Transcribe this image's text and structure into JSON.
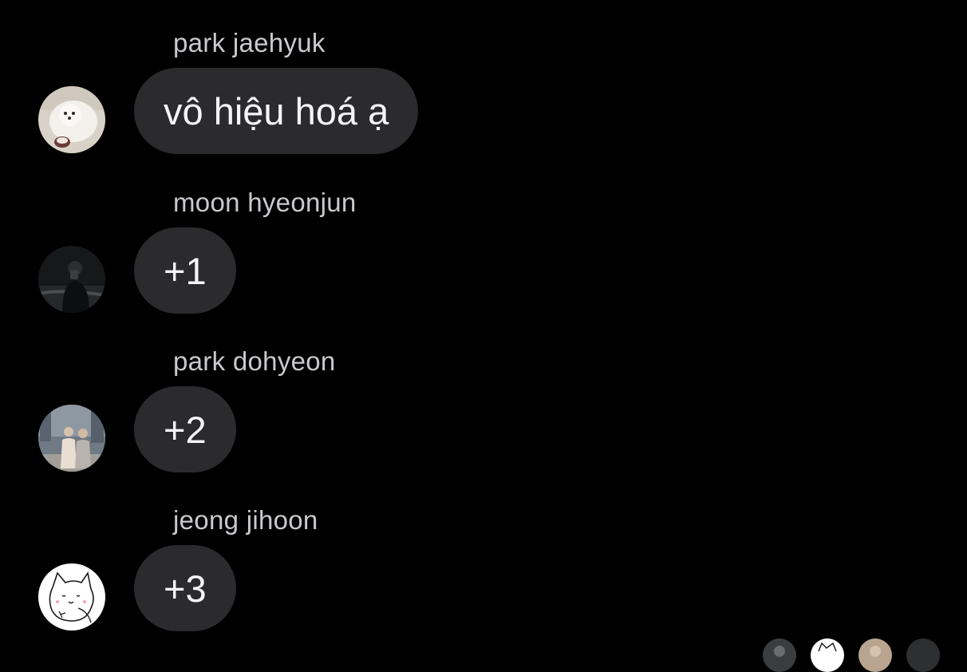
{
  "messages": [
    {
      "sender": "park jaehyuk",
      "text": "vô hiệu hoá ạ",
      "avatar_icon": "pomeranian-dog-photo-icon"
    },
    {
      "sender": "moon hyeonjun",
      "text": "+1",
      "avatar_icon": "person-night-photo-icon"
    },
    {
      "sender": "park dohyeon",
      "text": "+2",
      "avatar_icon": "two-people-street-photo-icon"
    },
    {
      "sender": "jeong jihoon",
      "text": "+3",
      "avatar_icon": "cartoon-cat-drawing-icon"
    }
  ],
  "colors": {
    "background": "#000000",
    "bubble": "#2b2b2e",
    "sender_name": "#c9c9ce",
    "message_text": "#f5f5f7"
  }
}
